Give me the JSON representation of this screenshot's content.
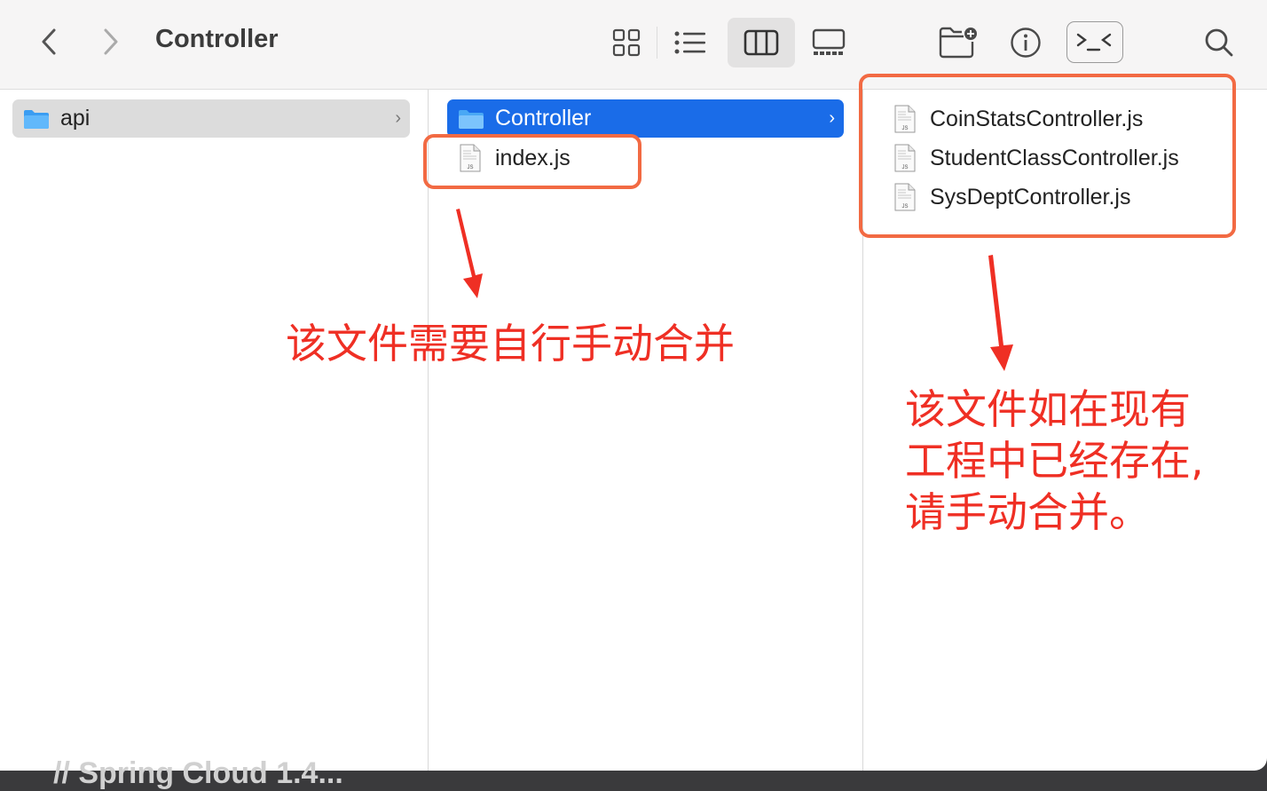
{
  "window": {
    "title": "Controller"
  },
  "toolbar": {
    "icons": [
      "chevron-left-icon",
      "chevron-right-icon",
      "grid-view-icon",
      "list-view-icon",
      "column-view-icon",
      "gallery-view-icon",
      "new-folder-icon",
      "info-icon",
      "terminal-icon",
      "search-icon"
    ],
    "active_view": "columns"
  },
  "columns": [
    {
      "items": [
        {
          "label": "api",
          "type": "folder",
          "selected": true,
          "has_children": true
        }
      ]
    },
    {
      "items": [
        {
          "label": "Controller",
          "type": "folder",
          "selected": true,
          "has_children": true
        },
        {
          "label": "index.js",
          "type": "file",
          "badge": "JS"
        }
      ]
    },
    {
      "items": [
        {
          "label": "CoinStatsController.js",
          "type": "file",
          "badge": "JS"
        },
        {
          "label": "StudentClassController.js",
          "type": "file",
          "badge": "JS"
        },
        {
          "label": "SysDeptController.js",
          "type": "file",
          "badge": "JS"
        }
      ]
    }
  ],
  "annotations": {
    "note1": "该文件需要自行手动合并",
    "note2_line1": "该文件如在现有",
    "note2_line2": "工程中已经存在,",
    "note2_line3": "请手动合并。",
    "color": "#ef2f24",
    "box_color": "#f26a43"
  },
  "background_text": "// Spring Cloud 1.4..."
}
